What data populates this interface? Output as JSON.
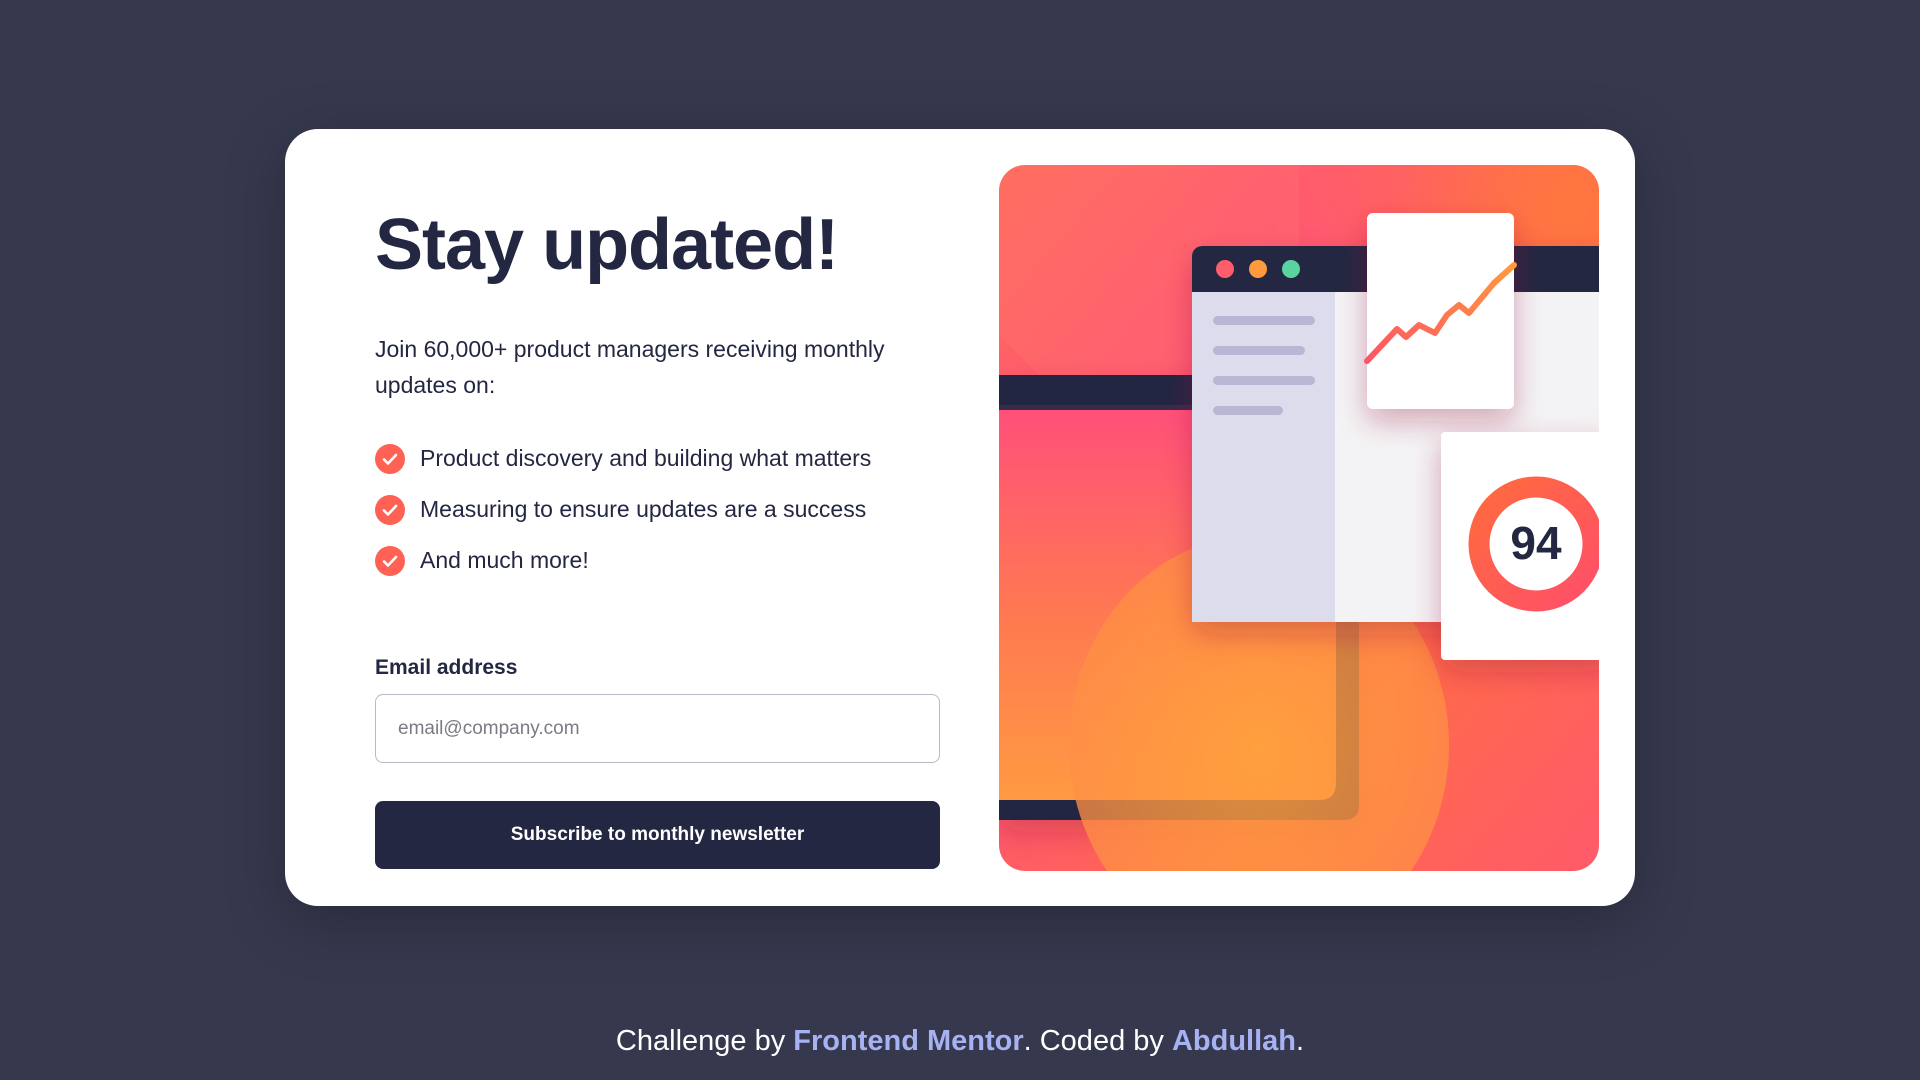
{
  "card": {
    "title": "Stay updated!",
    "intro": "Join 60,000+ product managers receiving monthly updates on:",
    "features": [
      "Product discovery and building what matters",
      "Measuring to ensure updates are a success",
      "And much more!"
    ],
    "form": {
      "email_label": "Email address",
      "email_placeholder": "email@company.com",
      "email_value": "",
      "submit_label": "Subscribe to monthly newsletter"
    },
    "illustration": {
      "score_value": "94"
    }
  },
  "footer": {
    "prefix": "Challenge by ",
    "link1": "Frontend Mentor",
    "middle": ". Coded by ",
    "link2": "Abdullah",
    "suffix": "."
  },
  "colors": {
    "background": "#36384e",
    "card": "#ffffff",
    "text_dark": "#242742",
    "accent_tomato": "#ff6155",
    "button": "#242742",
    "footer_link": "#a7b2f2"
  },
  "icons": {
    "feature_check": "check-circle-icon"
  }
}
